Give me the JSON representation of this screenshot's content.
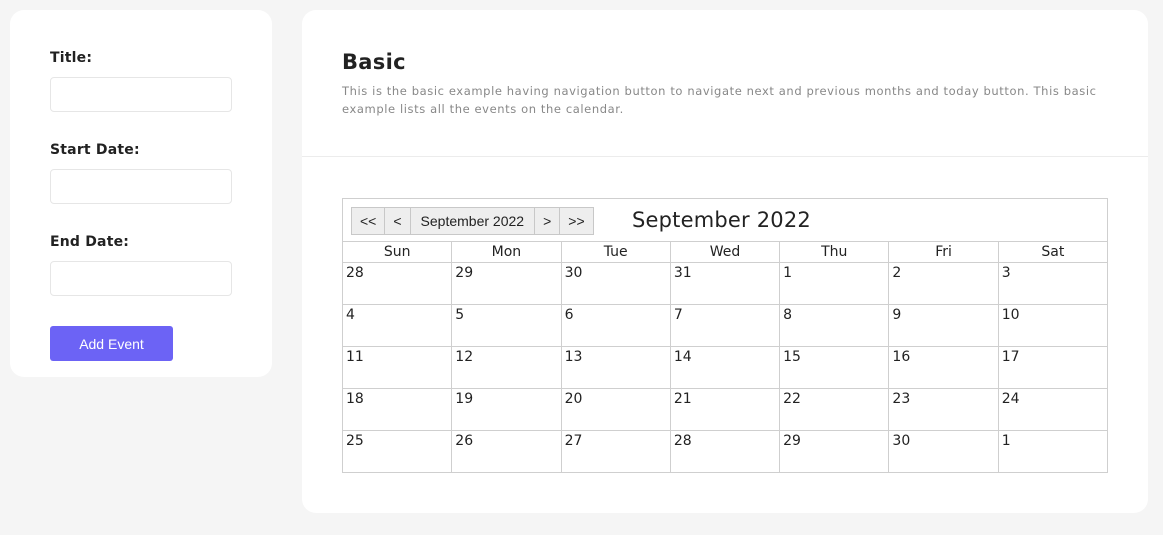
{
  "form": {
    "title_label": "Title:",
    "start_label": "Start Date:",
    "end_label": "End Date:",
    "submit_label": "Add Event"
  },
  "main": {
    "title": "Basic",
    "description": "This is the basic example having navigation button to navigate next and previous months and today button. This basic example lists all the events on the calendar."
  },
  "calendar": {
    "nav": {
      "prev_year": "<<",
      "prev_month": "<",
      "month_select": "September 2022",
      "next_month": ">",
      "next_year": ">>"
    },
    "title": "September 2022",
    "weekdays": [
      "Sun",
      "Mon",
      "Tue",
      "Wed",
      "Thu",
      "Fri",
      "Sat"
    ],
    "weeks": [
      [
        "28",
        "29",
        "30",
        "31",
        "1",
        "2",
        "3"
      ],
      [
        "4",
        "5",
        "6",
        "7",
        "8",
        "9",
        "10"
      ],
      [
        "11",
        "12",
        "13",
        "14",
        "15",
        "16",
        "17"
      ],
      [
        "18",
        "19",
        "20",
        "21",
        "22",
        "23",
        "24"
      ],
      [
        "25",
        "26",
        "27",
        "28",
        "29",
        "30",
        "1"
      ]
    ]
  }
}
